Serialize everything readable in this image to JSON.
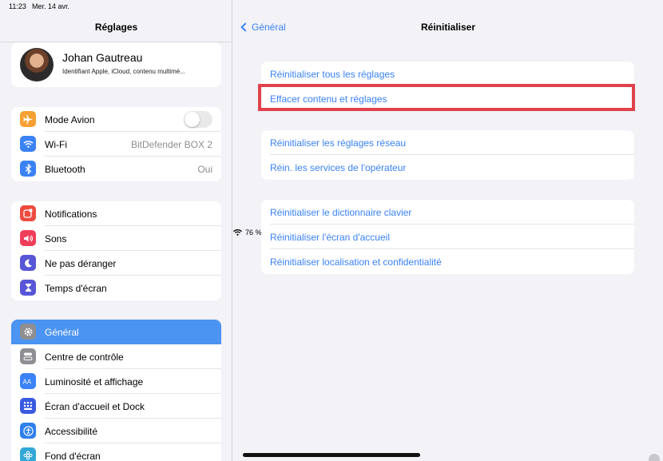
{
  "status": {
    "time": "11:23",
    "date": "Mer. 14 avr.",
    "battery": "76 %",
    "battery_level": 0.76
  },
  "sidebar": {
    "title": "Réglages",
    "profile": {
      "name": "Johan Gautreau",
      "subtitle": "Identifiant Apple, iCloud, contenu multimé..."
    },
    "groups": [
      [
        {
          "label": "Mode Avion",
          "icon": "airplane-icon",
          "color": "#f7a033",
          "toggle": false
        },
        {
          "label": "Wi-Fi",
          "icon": "wifi-icon",
          "color": "#3a82f6",
          "value": "BitDefender BOX 2"
        },
        {
          "label": "Bluetooth",
          "icon": "bluetooth-icon",
          "color": "#3a82f6",
          "value": "Oui"
        }
      ],
      [
        {
          "label": "Notifications",
          "icon": "notifications-icon",
          "color": "#ee4b3f"
        },
        {
          "label": "Sons",
          "icon": "speaker-icon",
          "color": "#ef3e5a"
        },
        {
          "label": "Ne pas déranger",
          "icon": "moon-icon",
          "color": "#5856d6"
        },
        {
          "label": "Temps d'écran",
          "icon": "hourglass-icon",
          "color": "#5856d6"
        }
      ],
      [
        {
          "label": "Général",
          "icon": "gear-icon",
          "color": "#8e8e93",
          "selected": true
        },
        {
          "label": "Centre de contrôle",
          "icon": "control-center-icon",
          "color": "#8e8e93"
        },
        {
          "label": "Luminosité et affichage",
          "icon": "brightness-icon",
          "color": "#3a82f6"
        },
        {
          "label": "Écran d'accueil et Dock",
          "icon": "home-screen-icon",
          "color": "#3a5be0"
        },
        {
          "label": "Accessibilité",
          "icon": "accessibility-icon",
          "color": "#2f80ed"
        },
        {
          "label": "Fond d'écran",
          "icon": "wallpaper-icon",
          "color": "#32a7d6"
        }
      ]
    ]
  },
  "main": {
    "back_label": "Général",
    "title": "Réinitialiser",
    "groups": [
      [
        "Réinitialiser tous les réglages",
        "Effacer contenu et réglages"
      ],
      [
        "Réinitialiser les réglages réseau",
        "Réin. les services de l'opérateur"
      ],
      [
        "Réinitialiser le dictionnaire clavier",
        "Réinitialiser l'écran d'accueil",
        "Réinitialiser localisation et confidentialité"
      ]
    ],
    "highlight_color": "#e0424b"
  }
}
